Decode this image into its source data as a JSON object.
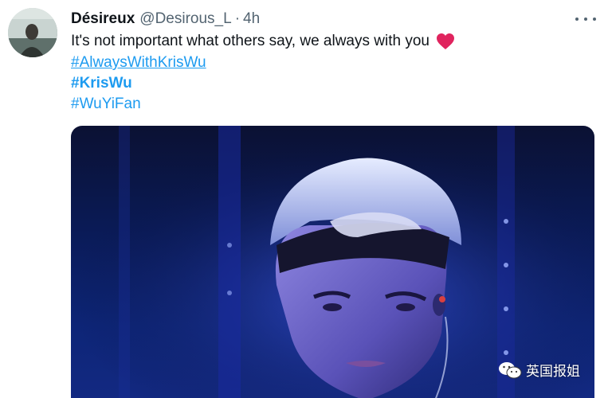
{
  "tweet": {
    "author": {
      "display_name": "Désireux",
      "handle": "@Desirous_L",
      "separator": "·",
      "time": "4h"
    },
    "text": "It's not important what others say, we always with you",
    "emoji": "red-heart-icon",
    "hashtags": [
      "#AlwaysWithKrisWu",
      "#KrisWu",
      "#WuYiFan"
    ],
    "more_icon": "more-horizontal-icon"
  },
  "watermark": {
    "icon": "wechat-icon",
    "text": "英国报姐"
  },
  "colors": {
    "link": "#1d9bf0",
    "secondary_text": "#536471",
    "primary_text": "#0f1419",
    "heart": "#e0245e",
    "stage_blue": "#0d2577"
  }
}
